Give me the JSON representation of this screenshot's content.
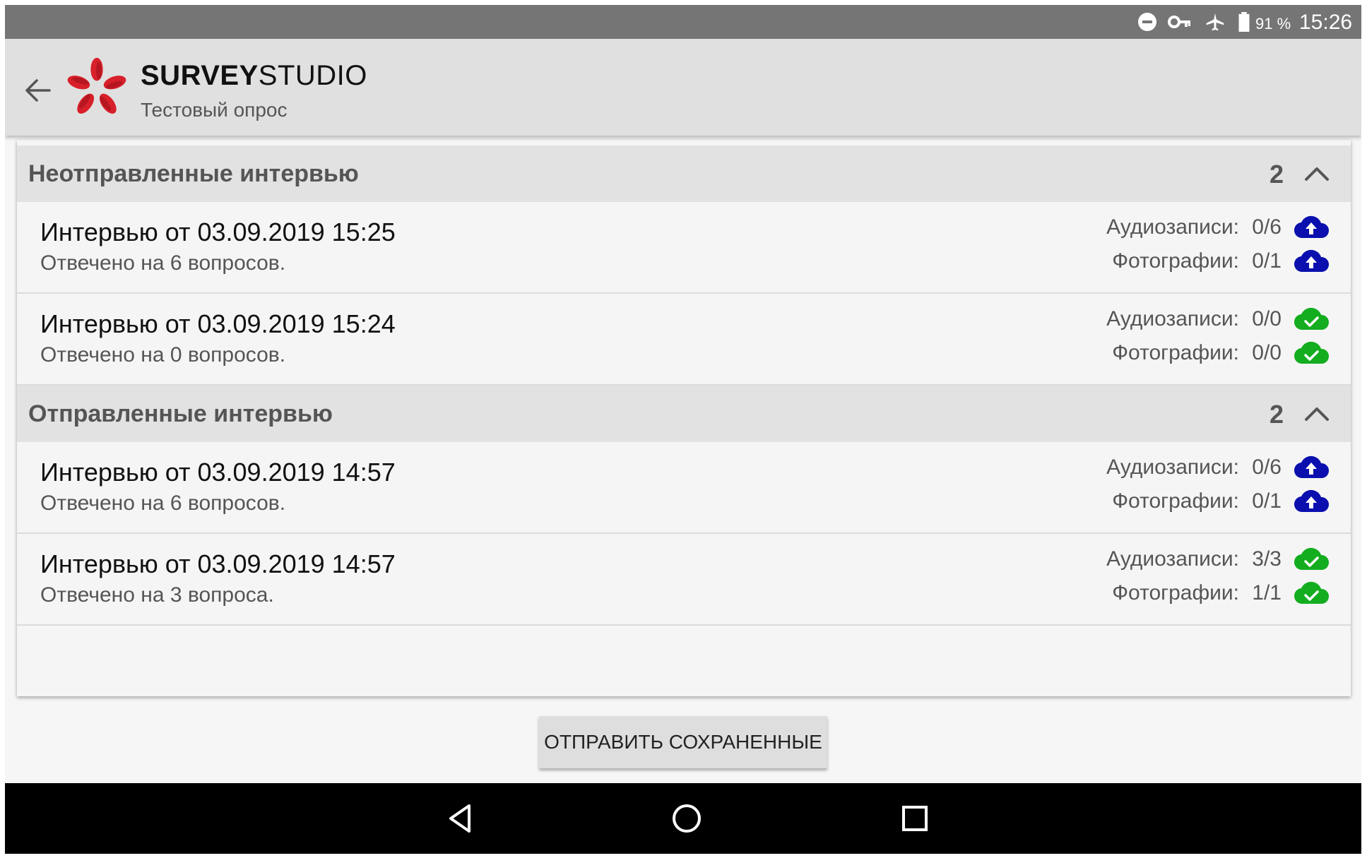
{
  "status_bar": {
    "battery_percent": "91 %",
    "time": "15:26",
    "icons": [
      "do-not-disturb-icon",
      "vpn-key-icon",
      "airplane-mode-icon",
      "battery-icon"
    ]
  },
  "app_bar": {
    "title_bold": "SURVEY",
    "title_regular": "STUDIO",
    "subtitle": "Тестовый опрос",
    "back_icon": "arrow-back-icon",
    "logo_icon": "flower-logo-icon"
  },
  "sections": [
    {
      "title": "Неотправленные интервью",
      "count": "2",
      "items": [
        {
          "title": "Интервью от 03.09.2019 15:25",
          "subtitle": "Отвечено на 6 вопросов.",
          "audio_label": "Аудиозаписи:",
          "audio_value": "0/6",
          "audio_status": "upload",
          "photo_label": "Фотографии:",
          "photo_value": "0/1",
          "photo_status": "upload"
        },
        {
          "title": "Интервью от 03.09.2019 15:24",
          "subtitle": "Отвечено на 0 вопросов.",
          "audio_label": "Аудиозаписи:",
          "audio_value": "0/0",
          "audio_status": "done",
          "photo_label": "Фотографии:",
          "photo_value": "0/0",
          "photo_status": "done"
        }
      ]
    },
    {
      "title": "Отправленные интервью",
      "count": "2",
      "items": [
        {
          "title": "Интервью от 03.09.2019 14:57",
          "subtitle": "Отвечено на 6 вопросов.",
          "audio_label": "Аудиозаписи:",
          "audio_value": "0/6",
          "audio_status": "upload",
          "photo_label": "Фотографии:",
          "photo_value": "0/1",
          "photo_status": "upload"
        },
        {
          "title": "Интервью от 03.09.2019 14:57",
          "subtitle": "Отвечено на 3 вопроса.",
          "audio_label": "Аудиозаписи:",
          "audio_value": "3/3",
          "audio_status": "done",
          "photo_label": "Фотографии:",
          "photo_value": "1/1",
          "photo_status": "done"
        }
      ]
    }
  ],
  "send_button": {
    "label": "ОТПРАВИТЬ СОХРАНЕННЫЕ"
  },
  "colors": {
    "upload": "#0a0fae",
    "done": "#13ad1f",
    "logo_red": "#d8202a"
  }
}
